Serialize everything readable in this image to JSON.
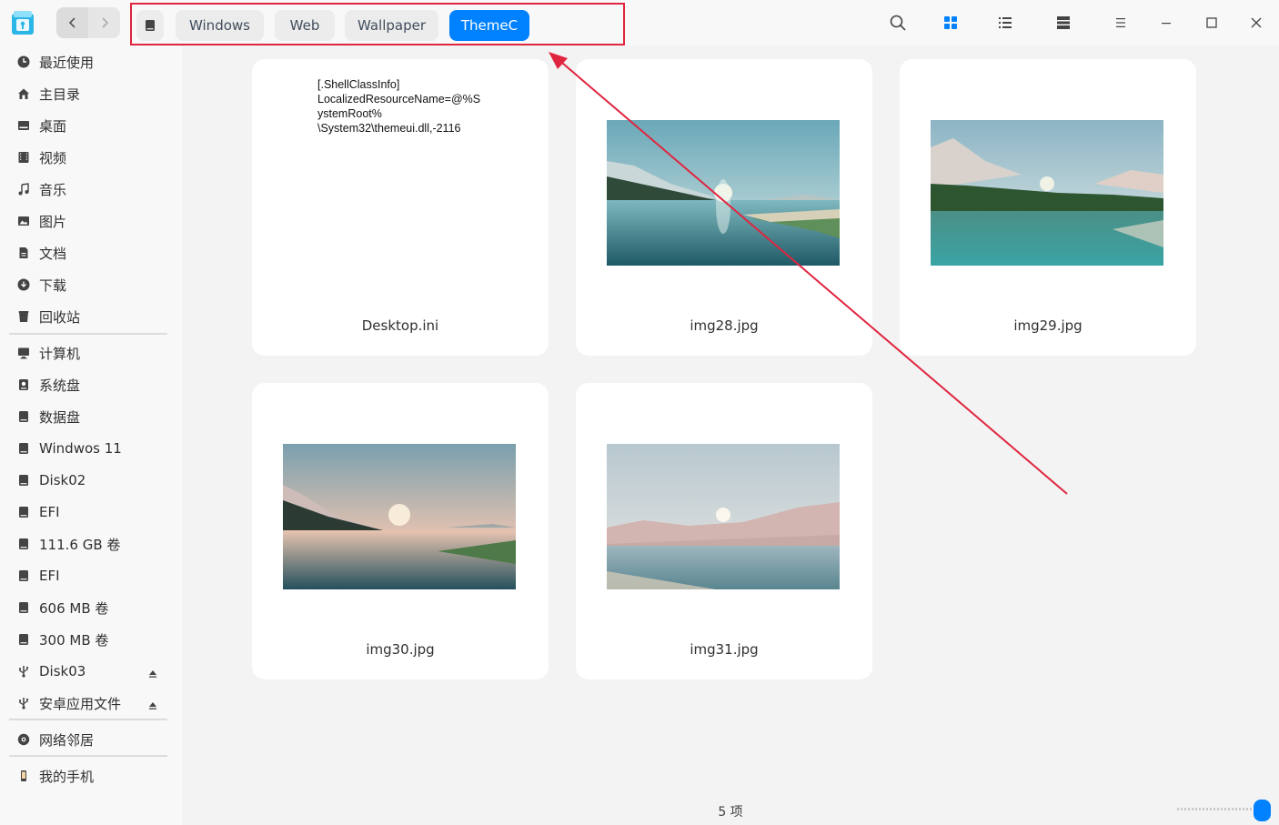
{
  "titlebar": {
    "breadcrumbs": [
      "Windows",
      "Web",
      "Wallpaper",
      "ThemeC"
    ],
    "active_crumb": "ThemeC",
    "accent_color": "#0081ff",
    "highlight_color": "#e0253f",
    "icons": [
      "back-icon",
      "forward-icon",
      "disk-icon",
      "search-icon",
      "grid-view-icon",
      "list-view-icon",
      "tree-view-icon",
      "menu-icon",
      "minimize-icon",
      "maximize-icon",
      "close-icon"
    ]
  },
  "sidebar": {
    "quick": [
      {
        "label": "最近使用",
        "icon": "clock-icon"
      },
      {
        "label": "主目录",
        "icon": "home-icon"
      },
      {
        "label": "桌面",
        "icon": "desktop-icon"
      },
      {
        "label": "视频",
        "icon": "video-icon"
      },
      {
        "label": "音乐",
        "icon": "music-icon"
      },
      {
        "label": "图片",
        "icon": "picture-icon"
      },
      {
        "label": "文档",
        "icon": "document-icon"
      },
      {
        "label": "下载",
        "icon": "download-icon"
      },
      {
        "label": "回收站",
        "icon": "trash-icon"
      }
    ],
    "devices": [
      {
        "label": "计算机",
        "icon": "computer-icon"
      },
      {
        "label": "系统盘",
        "icon": "system-disk-icon"
      },
      {
        "label": "数据盘",
        "icon": "disk-icon"
      },
      {
        "label": "Windwos 11",
        "icon": "disk-icon"
      },
      {
        "label": "Disk02",
        "icon": "disk-icon"
      },
      {
        "label": "EFI",
        "icon": "disk-icon"
      },
      {
        "label": "111.6 GB 卷",
        "icon": "disk-icon"
      },
      {
        "label": "EFI",
        "icon": "disk-icon"
      },
      {
        "label": "606 MB 卷",
        "icon": "disk-icon"
      },
      {
        "label": "300 MB 卷",
        "icon": "disk-icon"
      },
      {
        "label": "Disk03",
        "icon": "usb-icon"
      },
      {
        "label": "安卓应用文件",
        "icon": "usb-icon"
      }
    ],
    "network": [
      {
        "label": "网络邻居",
        "icon": "network-icon"
      }
    ],
    "phone": [
      {
        "label": "我的手机",
        "icon": "phone-icon"
      }
    ]
  },
  "files": [
    {
      "name": "Desktop.ini",
      "type": "text",
      "preview": "[.ShellClassInfo]\nLocalizedResourceName=@%S\nystemRoot%\n\\System32\\themeui.dll,-2116"
    },
    {
      "name": "img28.jpg",
      "type": "image",
      "scene": "lake-sunrise"
    },
    {
      "name": "img29.jpg",
      "type": "image",
      "scene": "forest-lake"
    },
    {
      "name": "img30.jpg",
      "type": "image",
      "scene": "sunset-river"
    },
    {
      "name": "img31.jpg",
      "type": "image",
      "scene": "dune-lake"
    }
  ],
  "status": {
    "count_text": "5 项"
  }
}
